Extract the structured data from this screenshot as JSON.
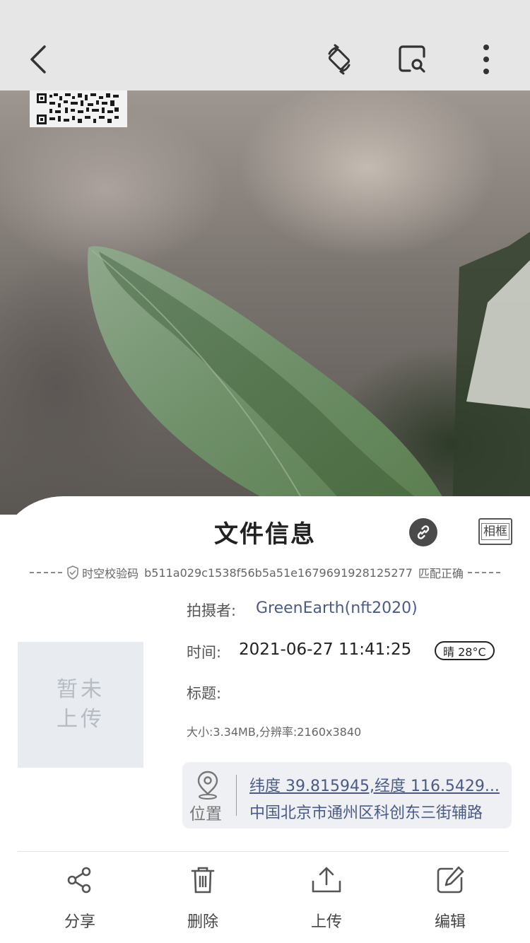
{
  "topbar": {
    "back_icon": "chevron-left-icon",
    "rotate_icon": "rotate-icon",
    "scan_icon": "scan-search-icon",
    "more_icon": "more-vertical-icon"
  },
  "sheet": {
    "title": "文件信息",
    "frame_label": "相框"
  },
  "verify": {
    "label": "时空校验码",
    "code": "b511a029c1538f56b5a51e1679691928125277",
    "status": "匹配正确"
  },
  "thumbnail": {
    "placeholder": "暂未上传"
  },
  "info": {
    "author_label": "拍摄者:",
    "author_value": "GreenEarth(nft2020)",
    "time_label": "时间:",
    "time_value": "2021-06-27 11:41:25",
    "weather": "晴 28°C",
    "title_label": "标题:",
    "size_line": "大小:3.34MB,分辨率:2160x3840"
  },
  "location": {
    "label": "位置",
    "coords": "纬度 39.815945,经度 116.5429...",
    "address": "中国北京市通州区科创东三街辅路"
  },
  "actions": [
    {
      "label": "分享",
      "icon": "share-icon"
    },
    {
      "label": "删除",
      "icon": "trash-icon"
    },
    {
      "label": "上传",
      "icon": "upload-icon"
    },
    {
      "label": "编辑",
      "icon": "edit-icon"
    }
  ]
}
